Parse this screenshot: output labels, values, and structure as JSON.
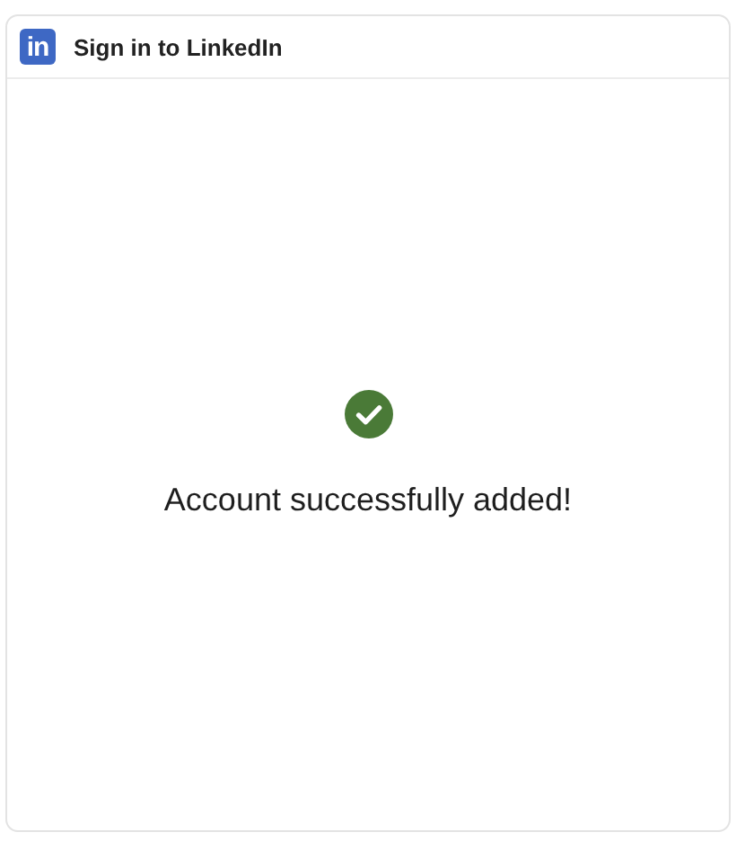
{
  "window": {
    "title": "Sign in to LinkedIn",
    "logo": "in"
  },
  "message": {
    "kind": "success",
    "text": "Account successfully added!"
  }
}
